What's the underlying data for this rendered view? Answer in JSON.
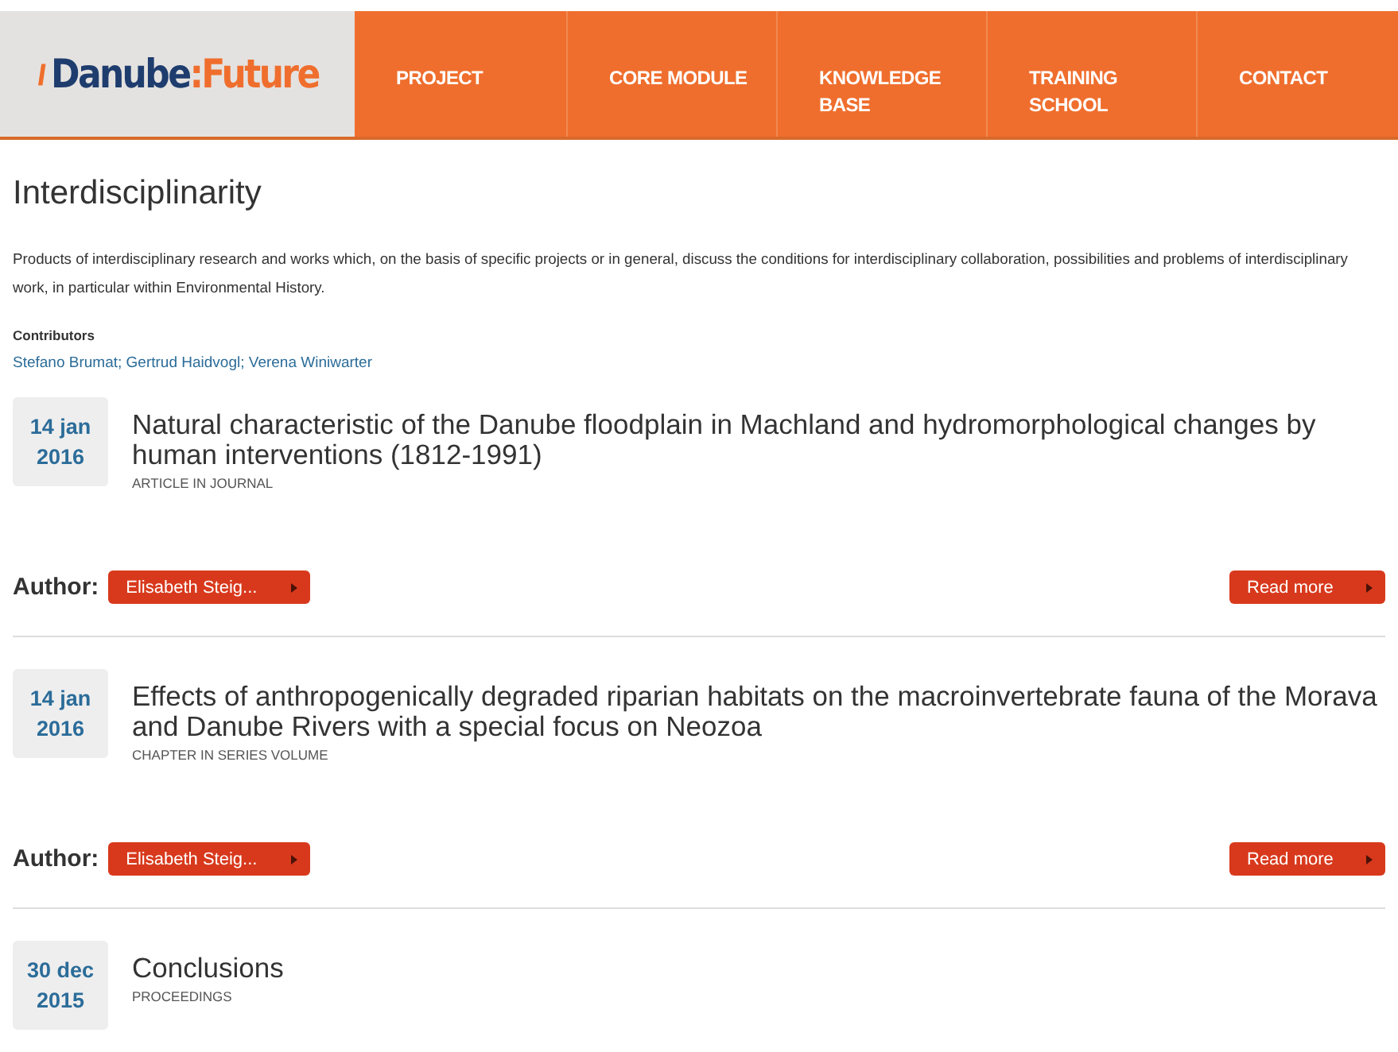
{
  "logo": {
    "main": "Danube",
    "accent": ":Future"
  },
  "nav": [
    {
      "label": "PROJECT"
    },
    {
      "label": "CORE MODULE"
    },
    {
      "label": "KNOWLEDGE BASE"
    },
    {
      "label": "TRAINING SCHOOL"
    },
    {
      "label": "CONTACT"
    }
  ],
  "page_title": "Interdisciplinarity",
  "description": "Products of interdisciplinary research and works which, on the basis of specific projects or in general, discuss the conditions for interdisciplinary collaboration, possibilities and problems of interdisciplinary work, in particular within Environmental History.",
  "contributors": {
    "label": "Contributors",
    "names": "Stefano Brumat; Gertrud Haidvogl; Verena Winiwarter"
  },
  "entries": [
    {
      "day": "14 jan",
      "year": "2016",
      "title": "Natural characteristic of the Danube floodplain in Machland and hydromorphological changes by human interventions (1812-1991)",
      "type": "ARTICLE IN JOURNAL",
      "author_label": "Author:",
      "author": "Elisabeth Steig...",
      "read_more": "Read more"
    },
    {
      "day": "14 jan",
      "year": "2016",
      "title": "Effects of anthropogenically degraded riparian habitats on the macroinvertebrate fauna of the Morava and Danube Rivers with a special focus on Neozoa",
      "type": "CHAPTER IN SERIES VOLUME",
      "author_label": "Author:",
      "author": "Elisabeth Steig...",
      "read_more": "Read more"
    },
    {
      "day": "30 dec",
      "year": "2015",
      "title": "Conclusions",
      "type": "PROCEEDINGS"
    }
  ]
}
